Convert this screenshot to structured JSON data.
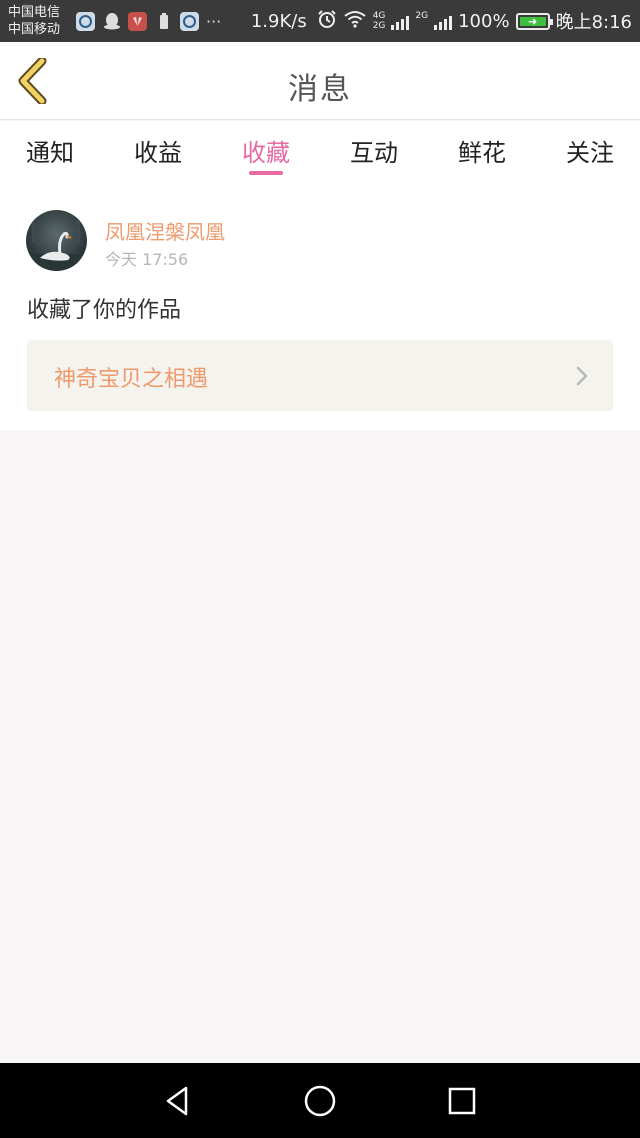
{
  "status_bar": {
    "carrier_1": "中国电信",
    "carrier_2": "中国移动",
    "apps": [
      "q-browser-icon",
      "qq-icon",
      "huawei-icon",
      "battery-saver-icon",
      "q-browser-icon"
    ],
    "more": "···",
    "net_speed": "1.9K/s",
    "sim1_label_top": "4G",
    "sim1_label_bottom": "2G",
    "sim2_label": "2G",
    "battery": "100%",
    "time": "晚上8:16"
  },
  "header": {
    "title": "消息",
    "back_icon": "chevron-left-icon"
  },
  "tabs": [
    {
      "label": "通知",
      "active": false
    },
    {
      "label": "收益",
      "active": false
    },
    {
      "label": "收藏",
      "active": true
    },
    {
      "label": "互动",
      "active": false
    },
    {
      "label": "鲜花",
      "active": false
    },
    {
      "label": "关注",
      "active": false
    }
  ],
  "message": {
    "username": "凤凰涅槃凤凰",
    "timestamp": "今天 17:56",
    "action": "收藏了你的作品",
    "work_title": "神奇宝贝之相遇"
  },
  "colors": {
    "accent_pink": "#e86aa3",
    "accent_orange": "#ee9a6c",
    "back_arrow": "#f2d264"
  },
  "nav_bar": {
    "buttons": [
      "back-triangle-icon",
      "home-circle-icon",
      "recents-square-icon"
    ]
  }
}
